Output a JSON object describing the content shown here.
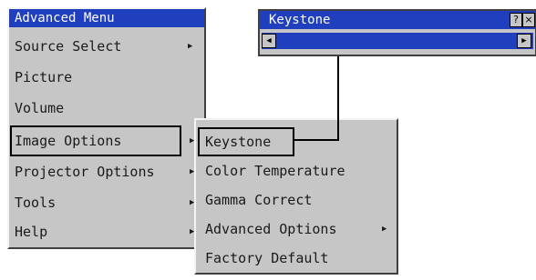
{
  "main_menu": {
    "title": "Advanced Menu",
    "items": [
      {
        "label": "Source Select",
        "has_submenu": true
      },
      {
        "label": "Picture",
        "has_submenu": false
      },
      {
        "label": "Volume",
        "has_submenu": false
      },
      {
        "label": "Image Options",
        "has_submenu": true,
        "selected": true
      },
      {
        "label": "Projector Options",
        "has_submenu": true
      },
      {
        "label": "Tools",
        "has_submenu": true
      },
      {
        "label": "Help",
        "has_submenu": true
      }
    ]
  },
  "submenu": {
    "items": [
      {
        "label": "Keystone",
        "has_submenu": false,
        "selected": true
      },
      {
        "label": "Color Temperature",
        "has_submenu": false
      },
      {
        "label": "Gamma Correct",
        "has_submenu": false
      },
      {
        "label": "Advanced Options",
        "has_submenu": true
      },
      {
        "label": "Factory Default",
        "has_submenu": false
      }
    ]
  },
  "keystone_window": {
    "title": "Keystone",
    "help_icon": "question-icon",
    "close_icon": "close-icon"
  },
  "colors": {
    "titlebar": "#1f3fbe",
    "menu_bg": "#c6c6c6"
  }
}
